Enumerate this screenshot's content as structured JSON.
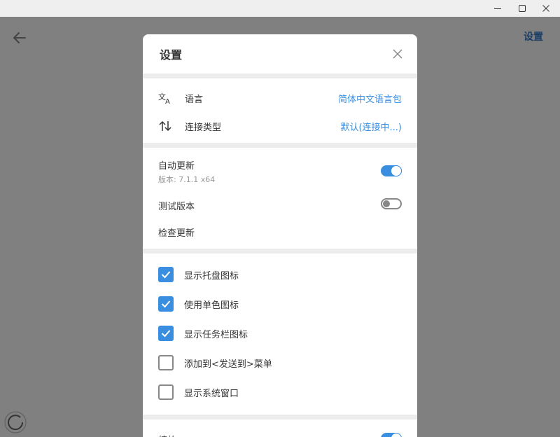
{
  "window": {
    "controls": [
      "minimize-icon",
      "maximize-icon",
      "close-icon"
    ]
  },
  "app": {
    "title": "设置",
    "back_icon": "arrow-left-icon",
    "spinner_icon": "loading-icon"
  },
  "dialog": {
    "title": "设置",
    "close_icon": "close-icon",
    "general": [
      {
        "icon": "translate-icon",
        "label": "语言",
        "value": "简体中文语言包"
      },
      {
        "icon": "swap-vertical-icon",
        "label": "连接类型",
        "value": "默认(连接中...)"
      }
    ],
    "updates": {
      "auto_update_label": "自动更新",
      "version_text": "版本: 7.1.1 x64",
      "auto_update_on": true,
      "beta_label": "测试版本",
      "beta_on": false,
      "check_label": "检查更新"
    },
    "checkboxes": [
      {
        "label": "显示托盘图标",
        "checked": true
      },
      {
        "label": "使用单色图标",
        "checked": true
      },
      {
        "label": "显示任务栏图标",
        "checked": true
      },
      {
        "label": "添加到<发送到>菜单",
        "checked": false
      },
      {
        "label": "显示系统窗口",
        "checked": false
      }
    ],
    "zoom": {
      "label": "缩放",
      "on": true
    }
  },
  "colors": {
    "accent": "#3a8ee0",
    "overlay": "#808080",
    "title_dark": "#1a3d66"
  }
}
